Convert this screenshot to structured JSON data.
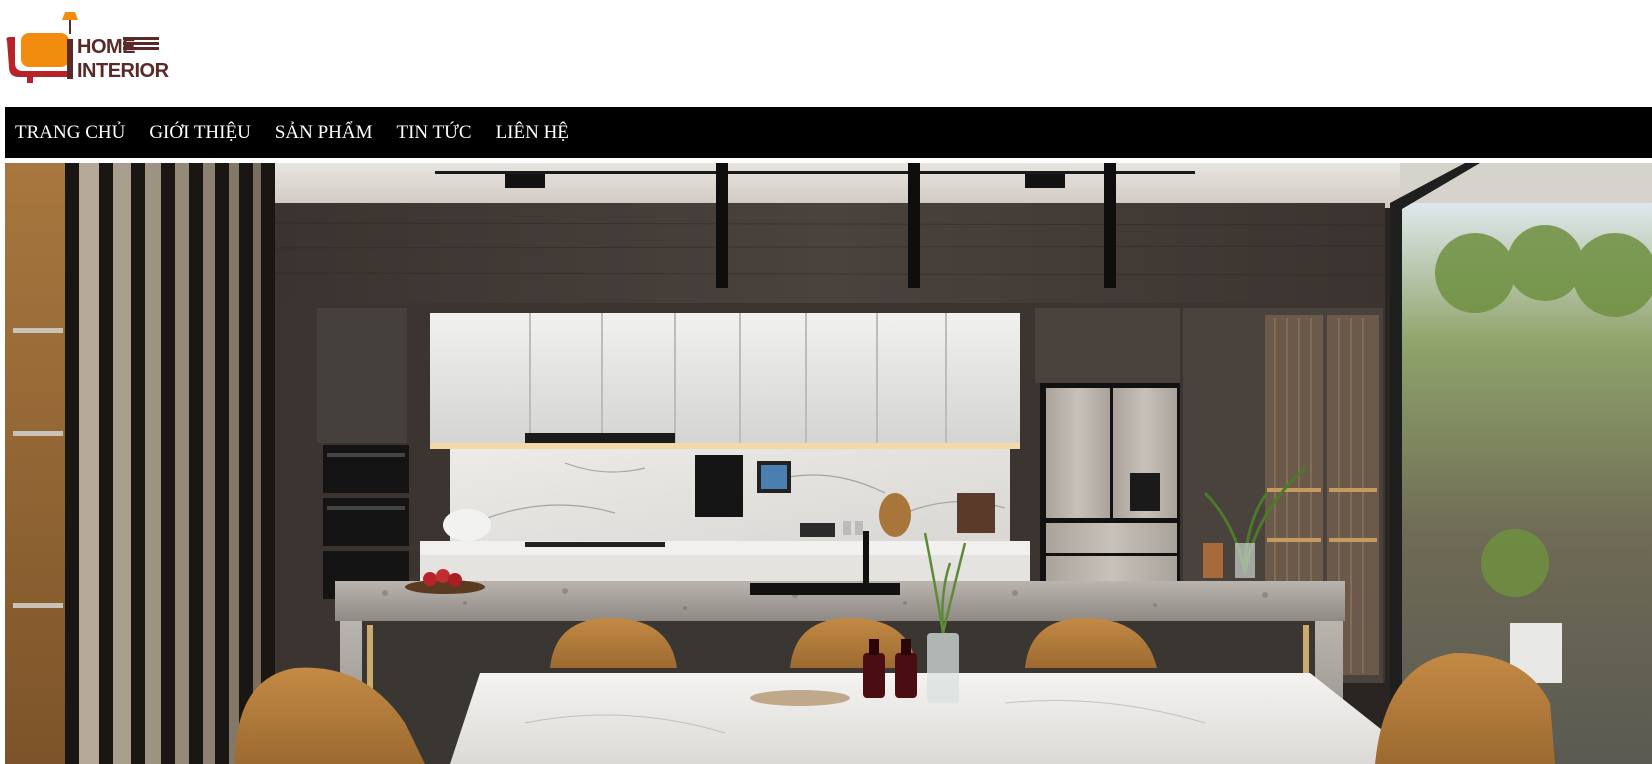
{
  "logo": {
    "line1": "HOME",
    "line2": "INTERIOR",
    "brand_color": "#5a2a2a",
    "sofa_color": "#f28c0f",
    "sofa_frame_color": "#b8232a"
  },
  "nav": {
    "items": [
      {
        "label": "TRANG CHỦ"
      },
      {
        "label": "GIỚI THIỆU"
      },
      {
        "label": "SẢN PHẨM"
      },
      {
        "label": "TIN TỨC"
      },
      {
        "label": "LIÊN HỆ"
      }
    ]
  },
  "hero": {
    "image": "modern-kitchen-banner"
  }
}
